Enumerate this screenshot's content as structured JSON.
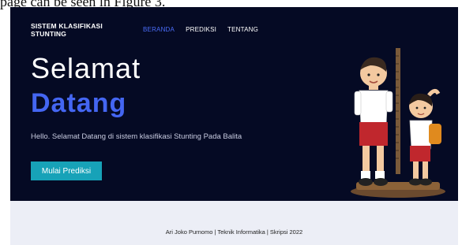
{
  "doc_caption": "page can be seen in Figure 3.",
  "navbar": {
    "brand": "SISTEM KLASIFIKASI STUNTING",
    "links": [
      "BERANDA",
      "PREDIKSI",
      "TENTANG"
    ],
    "active_link": "BERANDA"
  },
  "hero": {
    "title_line1": "Selamat",
    "title_line2": "Datang",
    "description": "Hello. Selamat Datang di sistem klasifikasi Stunting Pada Balita",
    "cta_label": "Mulai Prediksi",
    "illustration": "children-height-measurement-illustration"
  },
  "footer": {
    "text": "Ari Joko Purnomo | Teknik Informatika | Skripsi 2022"
  },
  "colors": {
    "hero_bg": "#050a24",
    "accent": "#4466f2",
    "cta_bg": "#17a2b8",
    "footer_bg": "#eceef6"
  }
}
